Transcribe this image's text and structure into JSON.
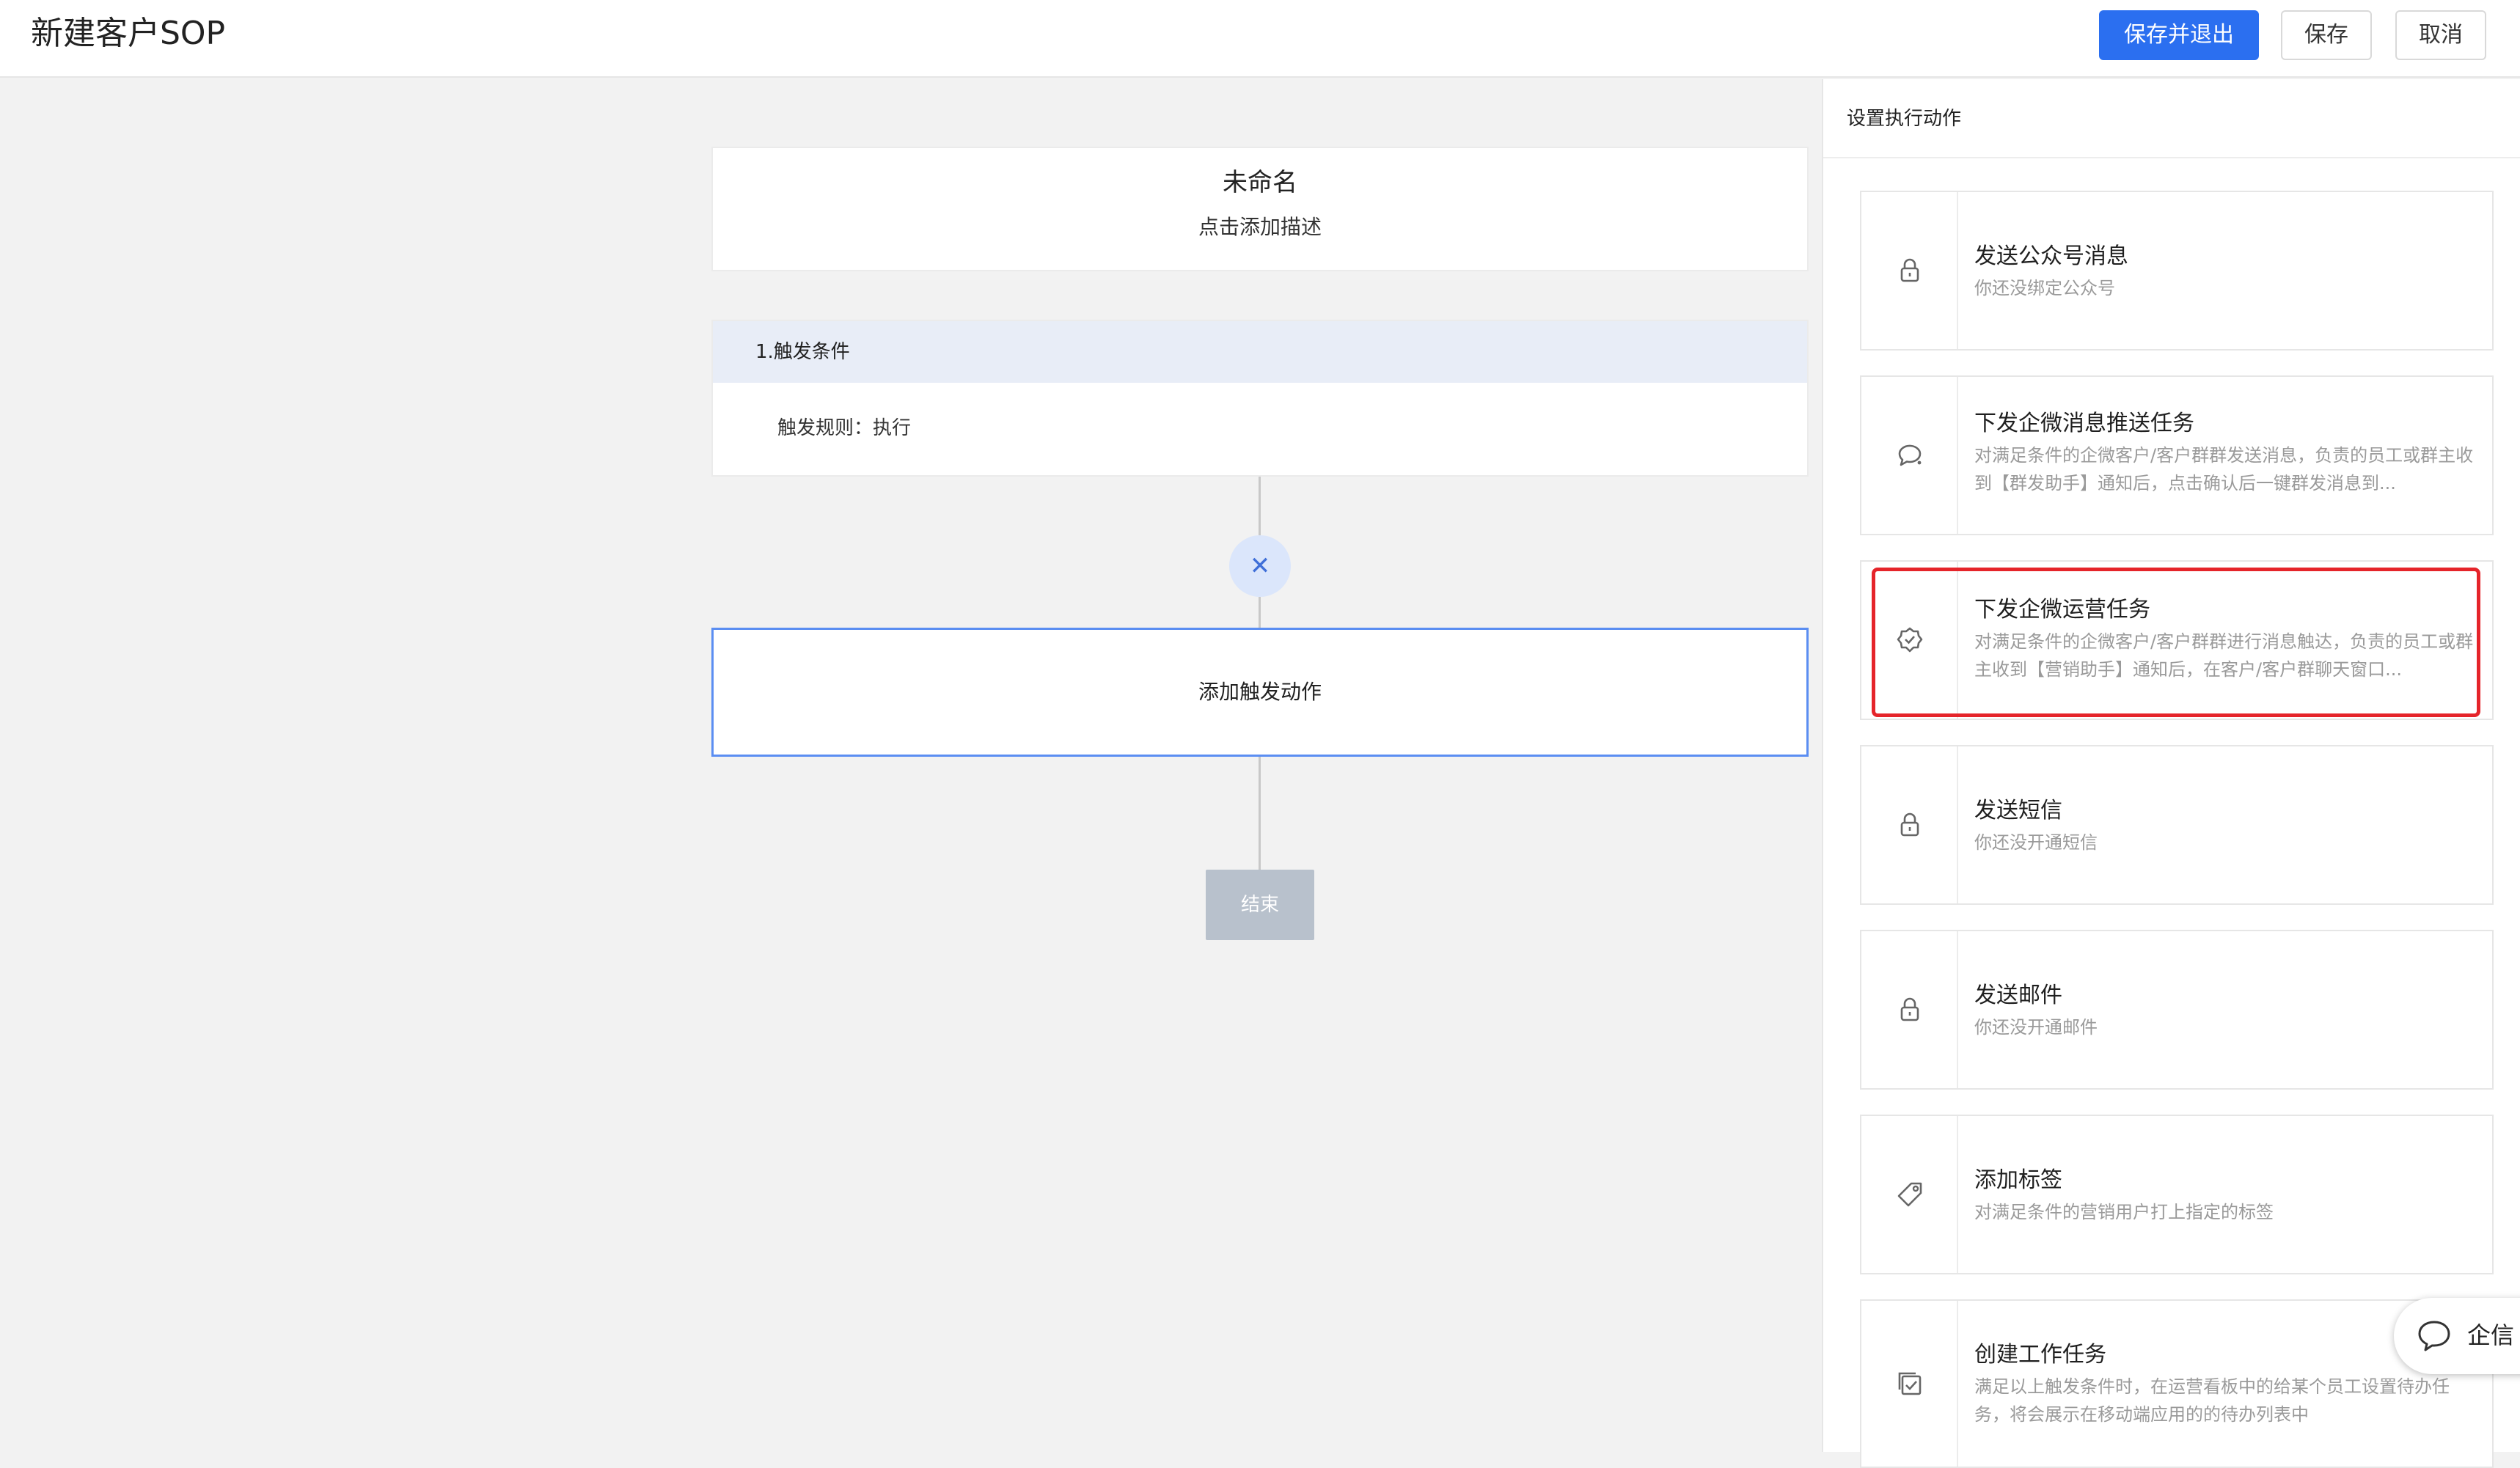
{
  "header": {
    "title": "新建客户SOP",
    "save_exit_label": "保存并退出",
    "save_label": "保存",
    "cancel_label": "取消",
    "accent_color": "#2b6ff0"
  },
  "flow": {
    "name": "未命名",
    "description": "点击添加描述",
    "condition_title": "1.触发条件",
    "condition_rule": "触发规则：执行",
    "add_action_label": "添加触发动作",
    "end_label": "结束"
  },
  "panel": {
    "title": "设置执行动作",
    "actions": [
      {
        "name": "发送公众号消息",
        "desc": "你还没绑定公众号",
        "icon": "lock-icon"
      },
      {
        "name": "下发企微消息推送任务",
        "desc": "对满足条件的企微客户/客户群群发送消息，负责的员工或群主收到【群发助手】通知后，点击确认后一键群发消息到...",
        "icon": "chat-icon"
      },
      {
        "name": "下发企微运营任务",
        "desc": "对满足条件的企微客户/客户群群进行消息触达，负责的员工或群主收到【营销助手】通知后，在客户/客户群聊天窗口...",
        "icon": "badge-icon",
        "highlighted": true
      },
      {
        "name": "发送短信",
        "desc": "你还没开通短信",
        "icon": "lock-icon"
      },
      {
        "name": "发送邮件",
        "desc": "你还没开通邮件",
        "icon": "lock-icon"
      },
      {
        "name": "添加标签",
        "desc": "对满足条件的营销用户打上指定的标签",
        "icon": "tag-icon"
      },
      {
        "name": "创建工作任务",
        "desc": "满足以上触发条件时，在运营看板中的给某个员工设置待办任务，将会展示在移动端应用的的待办列表中",
        "icon": "task-icon"
      }
    ],
    "highlight_color": "#e5242a"
  },
  "chat_widget": {
    "label": "企信"
  }
}
